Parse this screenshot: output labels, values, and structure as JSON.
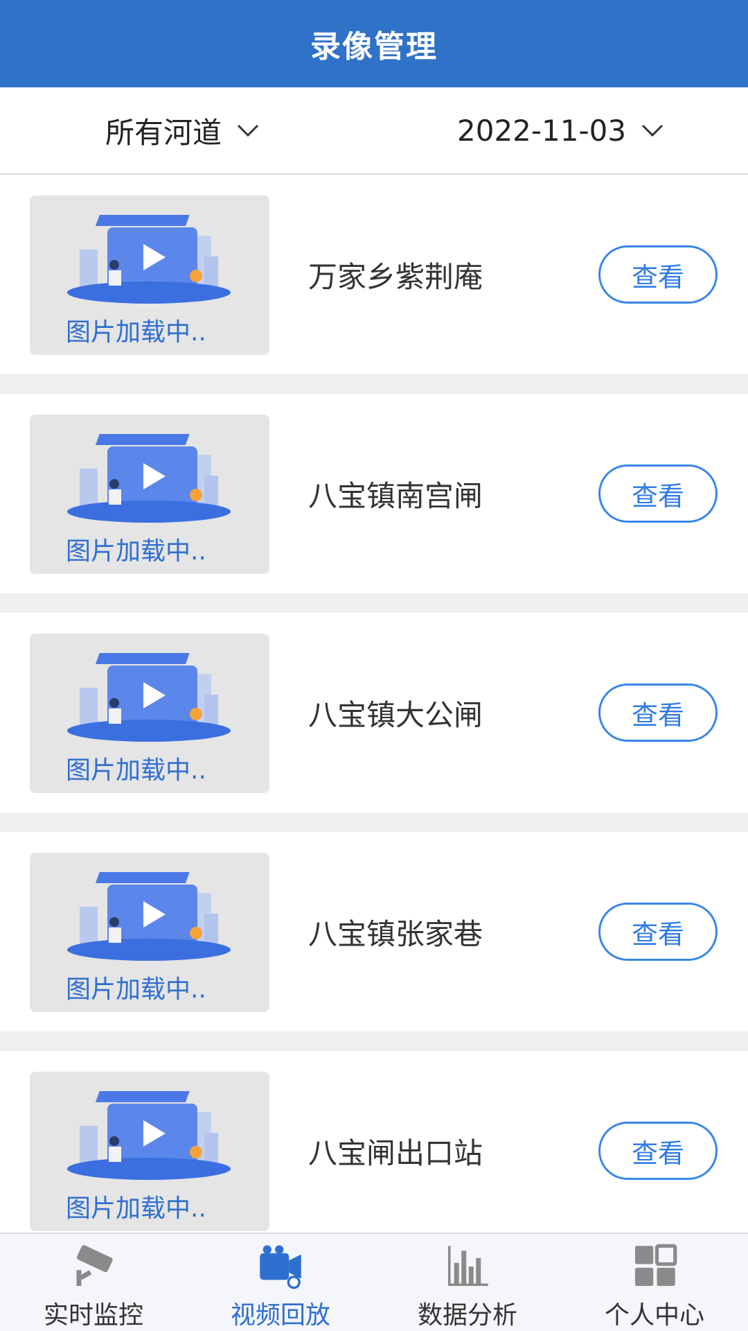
{
  "header": {
    "title": "录像管理"
  },
  "filters": {
    "river": "所有河道",
    "date": "2022-11-03"
  },
  "items": [
    {
      "thumb_text": "图片加载中..",
      "name": "万家乡紫荆庵",
      "action": "查看"
    },
    {
      "thumb_text": "图片加载中..",
      "name": "八宝镇南宫闸",
      "action": "查看"
    },
    {
      "thumb_text": "图片加载中..",
      "name": "八宝镇大公闸",
      "action": "查看"
    },
    {
      "thumb_text": "图片加载中..",
      "name": "八宝镇张家巷",
      "action": "查看"
    },
    {
      "thumb_text": "图片加载中..",
      "name": "八宝闸出口站",
      "action": "查看"
    }
  ],
  "tabs": [
    {
      "label": "实时监控",
      "icon": "cctv-camera-icon",
      "active": false
    },
    {
      "label": "视频回放",
      "icon": "video-playback-icon",
      "active": true
    },
    {
      "label": "数据分析",
      "icon": "bar-chart-icon",
      "active": false
    },
    {
      "label": "个人中心",
      "icon": "grid-user-icon",
      "active": false
    }
  ],
  "colors": {
    "header_bg": "#2f72c8",
    "accent": "#2f7be6",
    "tab_inactive": "#888888"
  }
}
